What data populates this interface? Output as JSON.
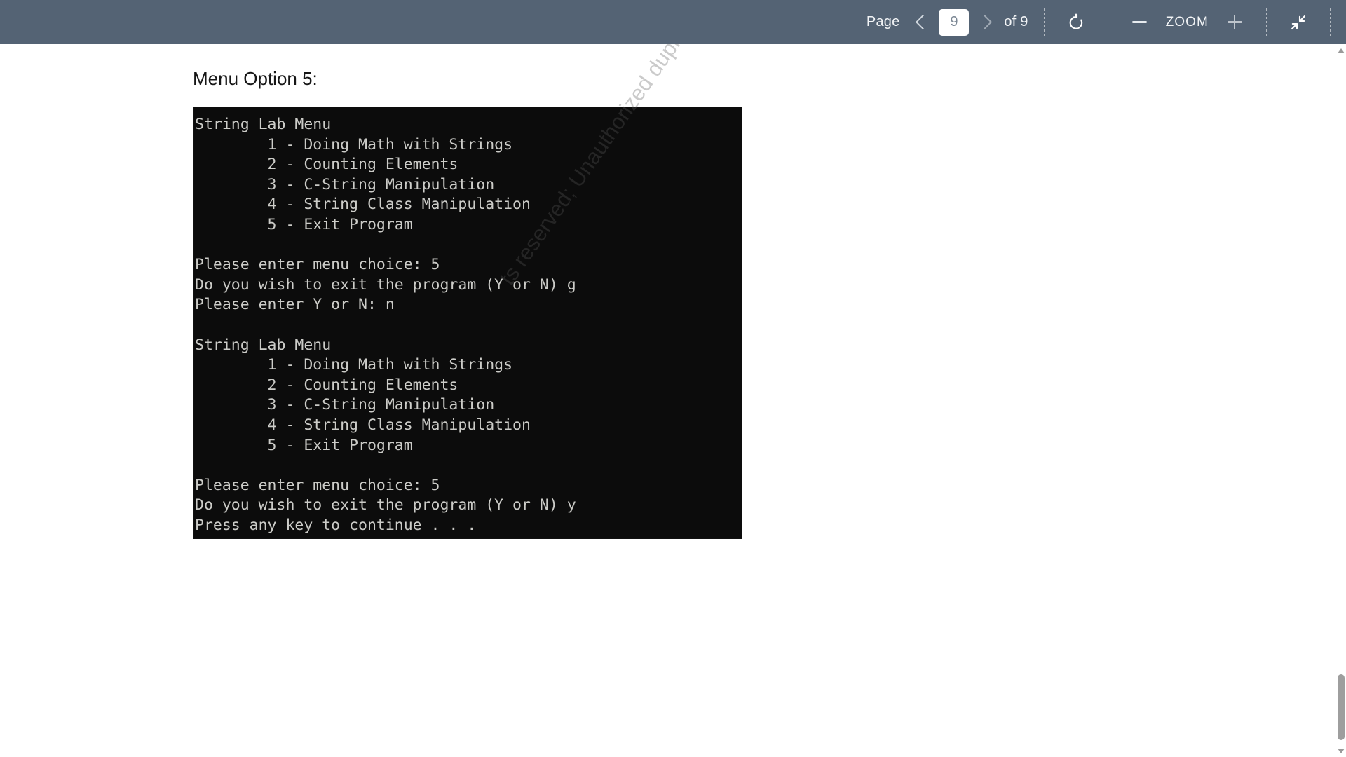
{
  "toolbar": {
    "page_label": "Page",
    "prev_page_icon": "chevron-left-icon",
    "page_value": "9",
    "next_page_icon": "chevron-right-icon",
    "of_label": "of 9",
    "rotate_icon": "rotate-icon",
    "zoom_out_label": "−",
    "zoom_label": "ZOOM",
    "zoom_in_label": "+",
    "collapse_icon": "collapse-fullscreen-icon",
    "bar_color": "#546374"
  },
  "document": {
    "heading": "Menu Option 5:",
    "watermark": "ts reserved; Unauthorized duplication prohibited.",
    "terminal": {
      "background": "#0c0c0c",
      "text_color": "#ccccc8",
      "lines": [
        "String Lab Menu",
        "        1 - Doing Math with Strings",
        "        2 - Counting Elements",
        "        3 - C-String Manipulation",
        "        4 - String Class Manipulation",
        "        5 - Exit Program",
        "",
        "Please enter menu choice: 5",
        "Do you wish to exit the program (Y or N) g",
        "Please enter Y or N: n",
        "",
        "String Lab Menu",
        "        1 - Doing Math with Strings",
        "        2 - Counting Elements",
        "        3 - C-String Manipulation",
        "        4 - String Class Manipulation",
        "        5 - Exit Program",
        "",
        "Please enter menu choice: 5",
        "Do you wish to exit the program (Y or N) y",
        "Press any key to continue . . ."
      ]
    }
  },
  "scrollbar": {
    "up_icon": "scroll-up-arrow-icon",
    "down_icon": "scroll-down-arrow-icon"
  }
}
